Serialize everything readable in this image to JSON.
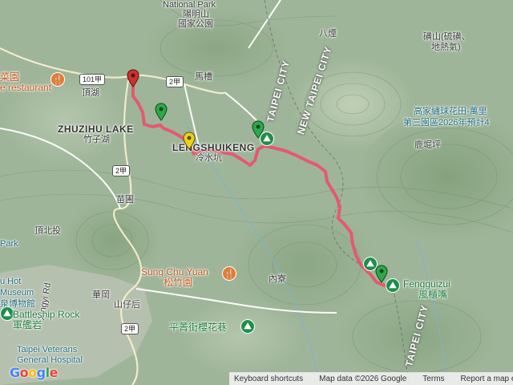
{
  "map": {
    "labels": {
      "national_park_en": "National Park",
      "national_park_zh1": "陽明山",
      "national_park_zh2": "國家公園",
      "bazhen": "八煙",
      "linshan": "磺山(硫磺、",
      "linshan2": "地熱氣)",
      "restaurant_zh": "菜園",
      "restaurant_en": "e restaurant",
      "road_101": "101甲",
      "road_2_a": "2甲",
      "road_2_b": "2甲",
      "road_2_c": "2甲",
      "macao": "馬槽",
      "dinghu": "頂湖",
      "zhuzihu_en": "ZHUZIHU LAKE",
      "zhuzihu_zh": "竹子湖",
      "lengshuikeng_en": "LENGSHUIKENG",
      "lengshuikeng_zh": "冷水坑",
      "taipei_city_1": "TAIPEI CITY",
      "new_taipei_city": "NEW TAIPEI CITY",
      "gaojia_1": "高家繡球花田-萬里",
      "gaojia_2": "第三園區2026年預計4",
      "luku": "鹿堀坪",
      "miaopu": "苗圃",
      "dingbeitou": "頂北投",
      "park": "Park",
      "hot_1": "u Hot",
      "hot_2": "Museum",
      "hot_3": "泉博物館",
      "xingyi": "Xingyi Rd",
      "huagang": "華岡",
      "shanzihou": "山仔后",
      "sungchuyuan_en": "Sung Chu Yuan",
      "sungchuyuan_zh": "松竹園",
      "neiliao": "內寮",
      "pingqing": "平菁街櫻花巷",
      "battleship_en": "Battleship Rock",
      "battleship_zh": "軍艦岩",
      "veterans_1": "Taipei Veterans",
      "veterans_2": "General Hospital",
      "fengguizui_en": "Fengguizui",
      "fengguizui_zh": "風櫃嘴",
      "taipei_city_2": "TAIPEI CITY"
    },
    "footer": {
      "keyboard": "Keyboard shortcuts",
      "mapdata": "Map data ©2026 Google",
      "terms": "Terms",
      "report": "Report a map error"
    },
    "google": "Google",
    "colors": {
      "route": "#e8546f",
      "marker_red": "#d0312d",
      "marker_green": "#2ea84a",
      "marker_yellow": "#e9d21f"
    }
  }
}
